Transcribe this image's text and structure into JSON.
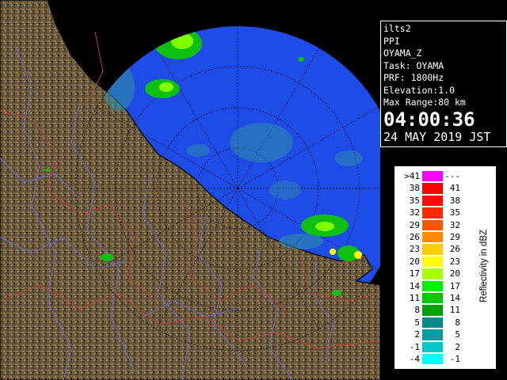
{
  "map": {
    "colors": {
      "sea": "#1f4be6",
      "land": "#6b5a3c",
      "land_dark": "#4a3c27",
      "land_light": "#8e7a55",
      "rivers": "#6a6ad8",
      "borders": "#c0403a",
      "echo_low": "#2e8fa6",
      "echo_mid": "#10c010",
      "echo_high": "#7fff00",
      "echo_peak": "#ffff00",
      "coast": "#101010"
    },
    "icons": [
      "range-ring-icon",
      "azimuth-line-icon"
    ]
  },
  "info": {
    "product": "ilts2",
    "mode": "PPI",
    "field": "OYAMA_Z",
    "task": "Task: OYAMA",
    "prf": "PRF: 1800Hz",
    "elevation": "Elevation:1.0",
    "max_range": "Max Range:80 km",
    "time": "04:00:36",
    "date": "24 MAY 2019 JST"
  },
  "legend": {
    "title": "Reflectivity in dBZ",
    "rows": [
      {
        "lo": ">41",
        "hi": "---",
        "color": "#ff00ff"
      },
      {
        "lo": "38",
        "hi": "41",
        "color": "#ff0000"
      },
      {
        "lo": "35",
        "hi": "38",
        "color": "#ff0a0a"
      },
      {
        "lo": "32",
        "hi": "35",
        "color": "#ff2a00"
      },
      {
        "lo": "29",
        "hi": "32",
        "color": "#ff5500"
      },
      {
        "lo": "26",
        "hi": "29",
        "color": "#ff8c00"
      },
      {
        "lo": "23",
        "hi": "26",
        "color": "#ffcc00"
      },
      {
        "lo": "20",
        "hi": "23",
        "color": "#ffff00"
      },
      {
        "lo": "17",
        "hi": "20",
        "color": "#a8ff00"
      },
      {
        "lo": "14",
        "hi": "17",
        "color": "#00ee00"
      },
      {
        "lo": "11",
        "hi": "14",
        "color": "#00c800"
      },
      {
        "lo": "8",
        "hi": "11",
        "color": "#00a000"
      },
      {
        "lo": "5",
        "hi": "8",
        "color": "#008a8a"
      },
      {
        "lo": "2",
        "hi": "5",
        "color": "#00a0a0"
      },
      {
        "lo": "-1",
        "hi": "2",
        "color": "#00c8c8"
      },
      {
        "lo": "-4",
        "hi": "-1",
        "color": "#00ffff"
      }
    ]
  }
}
